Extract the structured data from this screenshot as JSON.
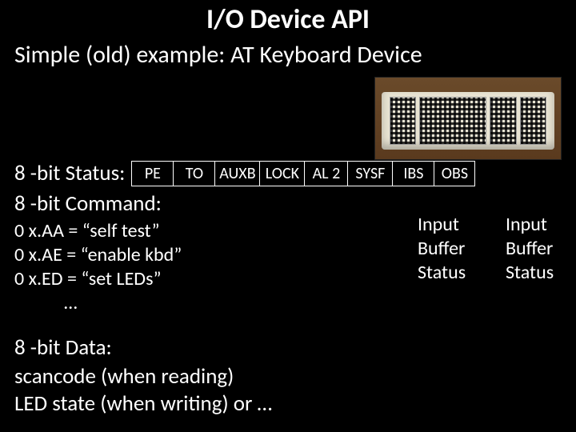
{
  "title": "I/O Device API",
  "subtitle": "Simple (old) example: AT Keyboard Device",
  "status": {
    "label": "8 -bit Status:",
    "bits": [
      "PE",
      "TO",
      "AUXB",
      "LOCK",
      "AL 2",
      "SYSF",
      "IBS",
      "OBS"
    ]
  },
  "command": {
    "label": "8 -bit Command:",
    "items": [
      "0 x.AA = “self test”",
      "0 x.AE = “enable kbd”",
      "0 x.ED = “set LEDs”"
    ],
    "ellipsis": "…"
  },
  "callouts": {
    "ibs": {
      "l1": "Input",
      "l2": "Buffer",
      "l3": "Status"
    },
    "obs": {
      "l1": "Input",
      "l2": "Buffer",
      "l3": "Status"
    }
  },
  "data": {
    "label": "8 -bit Data:",
    "line1": "scancode (when reading)",
    "line2": "LED state (when writing) or …"
  }
}
